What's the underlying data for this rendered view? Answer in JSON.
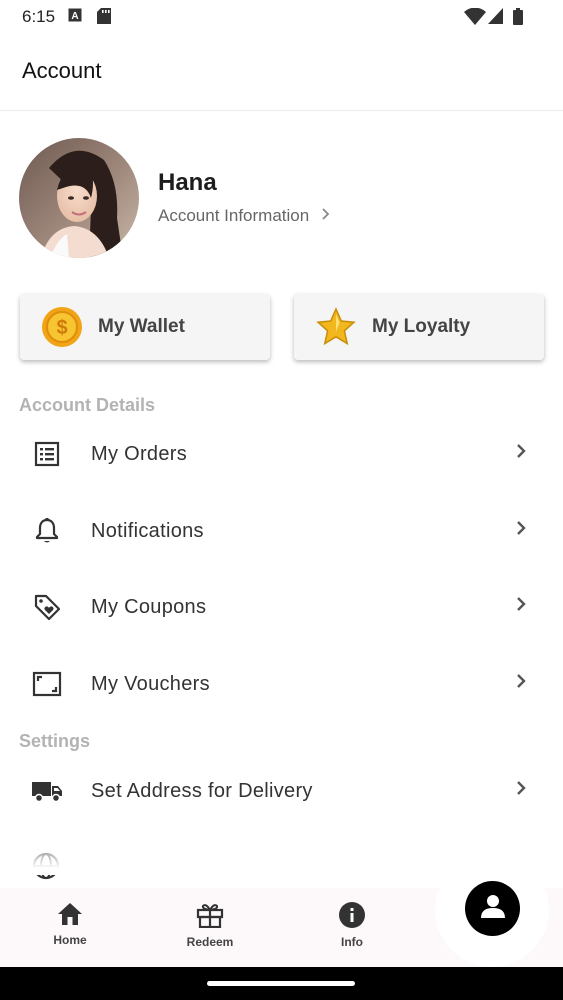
{
  "status_bar": {
    "time": "6:15"
  },
  "header": {
    "title": "Account"
  },
  "profile": {
    "name": "Hana",
    "account_link": "Account Information"
  },
  "cards": [
    {
      "label": "My Wallet",
      "icon": "coin-icon"
    },
    {
      "label": "My Loyalty",
      "icon": "star-icon"
    }
  ],
  "account_details": {
    "title": "Account Details",
    "items": [
      {
        "label": "My Orders",
        "icon": "list-icon"
      },
      {
        "label": "Notifications",
        "icon": "bell-icon"
      },
      {
        "label": "My Coupons",
        "icon": "tag-heart-icon"
      },
      {
        "label": "My Vouchers",
        "icon": "voucher-icon"
      }
    ]
  },
  "settings": {
    "title": "Settings",
    "items": [
      {
        "label": "Set Address for Delivery",
        "icon": "truck-icon"
      }
    ]
  },
  "bottom_nav": {
    "items": [
      {
        "label": "Home",
        "icon": "home-icon"
      },
      {
        "label": "Redeem",
        "icon": "gift-icon"
      },
      {
        "label": "Info",
        "icon": "info-icon"
      }
    ],
    "fab_icon": "person-icon"
  },
  "colors": {
    "accent": "#000000",
    "section_title": "#b3b3b3",
    "nav_background": "#fdf8fa"
  }
}
